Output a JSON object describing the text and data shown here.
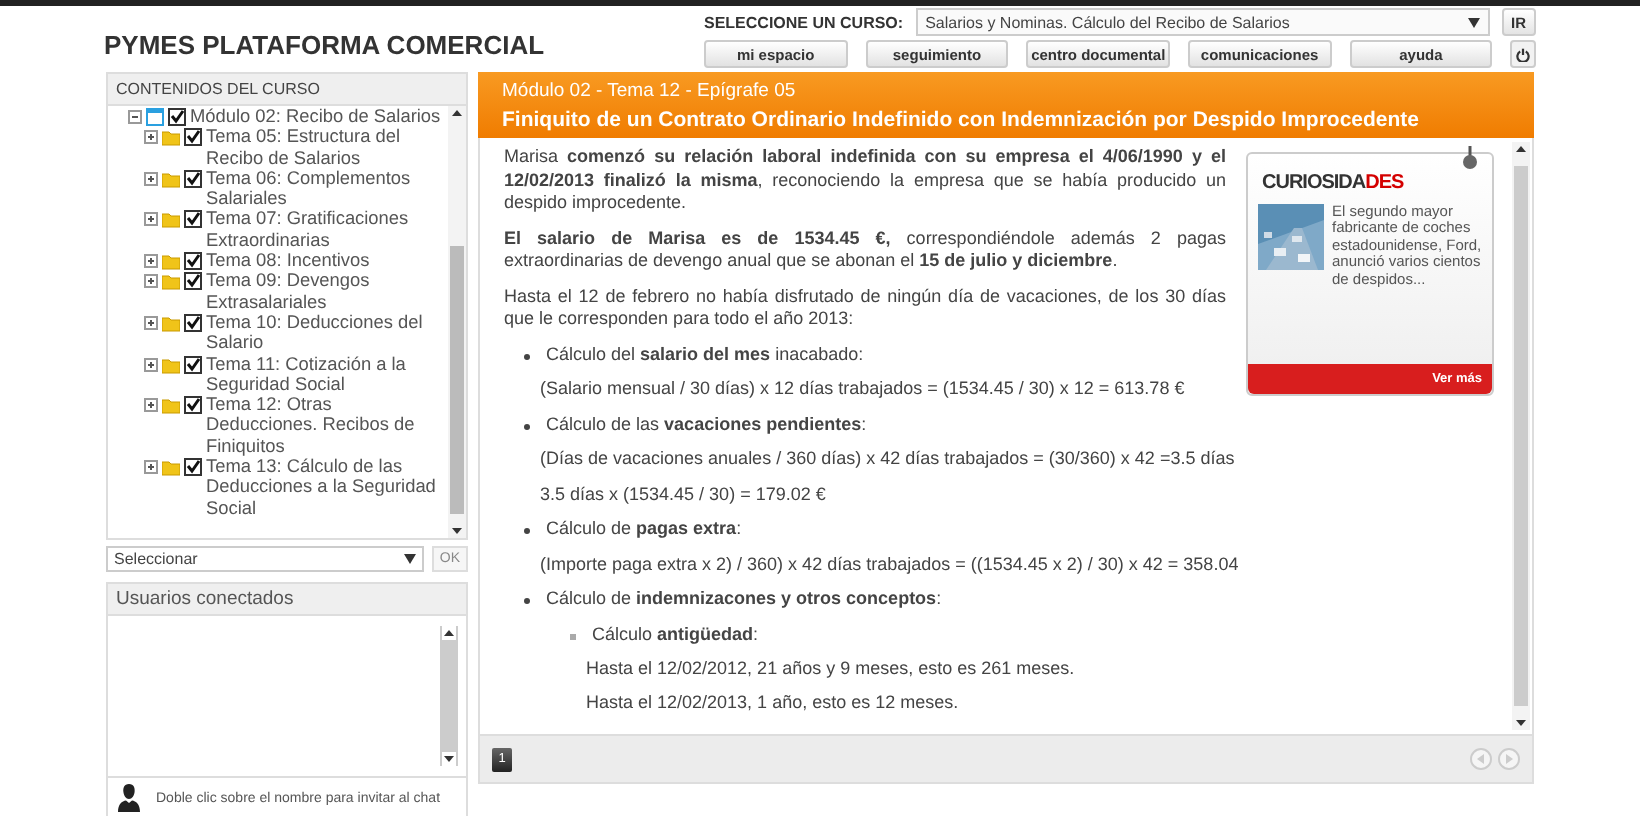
{
  "app_title": "PYMES PLATAFORMA COMERCIAL",
  "course_selector": {
    "label": "SELECCIONE UN CURSO:",
    "value": "Salarios y Nominas. Cálculo del Recibo de Salarios",
    "go_button": "IR"
  },
  "nav_buttons": [
    "mi espacio",
    "seguimiento",
    "centro documental",
    "comunicaciones",
    "ayuda"
  ],
  "sidebar": {
    "title": "CONTENIDOS DEL CURSO",
    "tree": [
      {
        "label": "Módulo 02: Recibo de Salarios",
        "kind": "module",
        "expanded": true,
        "checked": true,
        "children": [
          {
            "label": "Tema 05: Estructura del Recibo de Salarios",
            "kind": "topic",
            "expanded": false,
            "checked": true
          },
          {
            "label": "Tema 06: Complementos Salariales",
            "kind": "topic",
            "expanded": false,
            "checked": true
          },
          {
            "label": "Tema 07: Gratificaciones Extraordinarias",
            "kind": "topic",
            "expanded": false,
            "checked": true
          },
          {
            "label": "Tema 08: Incentivos",
            "kind": "topic",
            "expanded": false,
            "checked": true
          },
          {
            "label": "Tema 09: Devengos Extrasalariales",
            "kind": "topic",
            "expanded": false,
            "checked": true
          },
          {
            "label": "Tema 10: Deducciones del Salario",
            "kind": "topic",
            "expanded": false,
            "checked": true
          },
          {
            "label": "Tema 11: Cotización a la Seguridad Social",
            "kind": "topic",
            "expanded": false,
            "checked": true
          },
          {
            "label": "Tema 12: Otras Deducciones. Recibos de Finiquitos",
            "kind": "topic",
            "expanded": false,
            "checked": true
          },
          {
            "label": "Tema 13: Cálculo de las Deducciones a la Seguridad Social",
            "kind": "topic",
            "expanded": false,
            "checked": true
          }
        ]
      }
    ],
    "select": {
      "value": "Seleccionar",
      "button": "OK",
      "button_disabled": true
    }
  },
  "users": {
    "title": "Usuarios conectados",
    "hint": "Doble clic sobre el nombre para invitar al chat"
  },
  "lesson": {
    "breadcrumb": "Módulo 02 - Tema 12 - Epígrafe 05",
    "title": "Finiquito de un Contrato Ordinario Indefinido con Indemnización por Despido Improcedente",
    "content": [
      {
        "kind": "para",
        "text": "Marisa **comenzó su relación laboral indefinida con su empresa el 4/06/1990 y el 12/02/2013 finalizó la misma**, reconociendo la empresa que se había producido un despido improcedente."
      },
      {
        "kind": "para",
        "text": "**El salario de Marisa es de 1534.45 €,** correspondiéndole además 2 pagas extraordinarias de devengo anual que se abonan el **15 de julio y diciembre**."
      },
      {
        "kind": "para",
        "text": "Hasta el 12 de febrero no había disfrutado de ningún día de vacaciones, de los 30 días que le corresponden para todo el año 2013:"
      },
      {
        "kind": "bullet",
        "text": "Cálculo del **salario del mes** inacabado:"
      },
      {
        "kind": "line",
        "text": "(Salario mensual / 30 días) x 12 días trabajados = (1534.45 / 30) x 12 = 613.78 €"
      },
      {
        "kind": "bullet",
        "text": "Cálculo de las **vacaciones pendientes**:"
      },
      {
        "kind": "line",
        "text": "(Días de vacaciones anuales / 360 días) x 42 días trabajados = (30/360) x 42 =3.5 días"
      },
      {
        "kind": "line",
        "text": "3.5 días x (1534.45 / 30) = 179.02 €"
      },
      {
        "kind": "bullet",
        "text": "Cálculo de **pagas extra**:"
      },
      {
        "kind": "line",
        "text": "(Importe paga extra x 2) / 360) x 42 días trabajados = ((1534.45 x 2) / 30) x 42 = 358.04"
      },
      {
        "kind": "bullet",
        "text": "Cálculo de **indemnizacones y otros conceptos**:"
      },
      {
        "kind": "subbullet",
        "text": "Cálculo **antigüedad**:"
      },
      {
        "kind": "subline",
        "text": "Hasta el 12/02/2012, 21 años y 9 meses, esto es 261 meses."
      },
      {
        "kind": "subline",
        "text": "Hasta el 12/02/2013, 1 año, esto es 12 meses."
      }
    ],
    "card": {
      "logo_parts": [
        "CURIOSIDA",
        "DES"
      ],
      "text": "El segundo mayor fabricante de coches estadounidense, Ford, anunció varios cientos de despidos...",
      "link": "Ver más"
    },
    "pages": [
      {
        "label": "1",
        "selected": true
      }
    ],
    "prev_disabled": true,
    "next_disabled": true
  }
}
